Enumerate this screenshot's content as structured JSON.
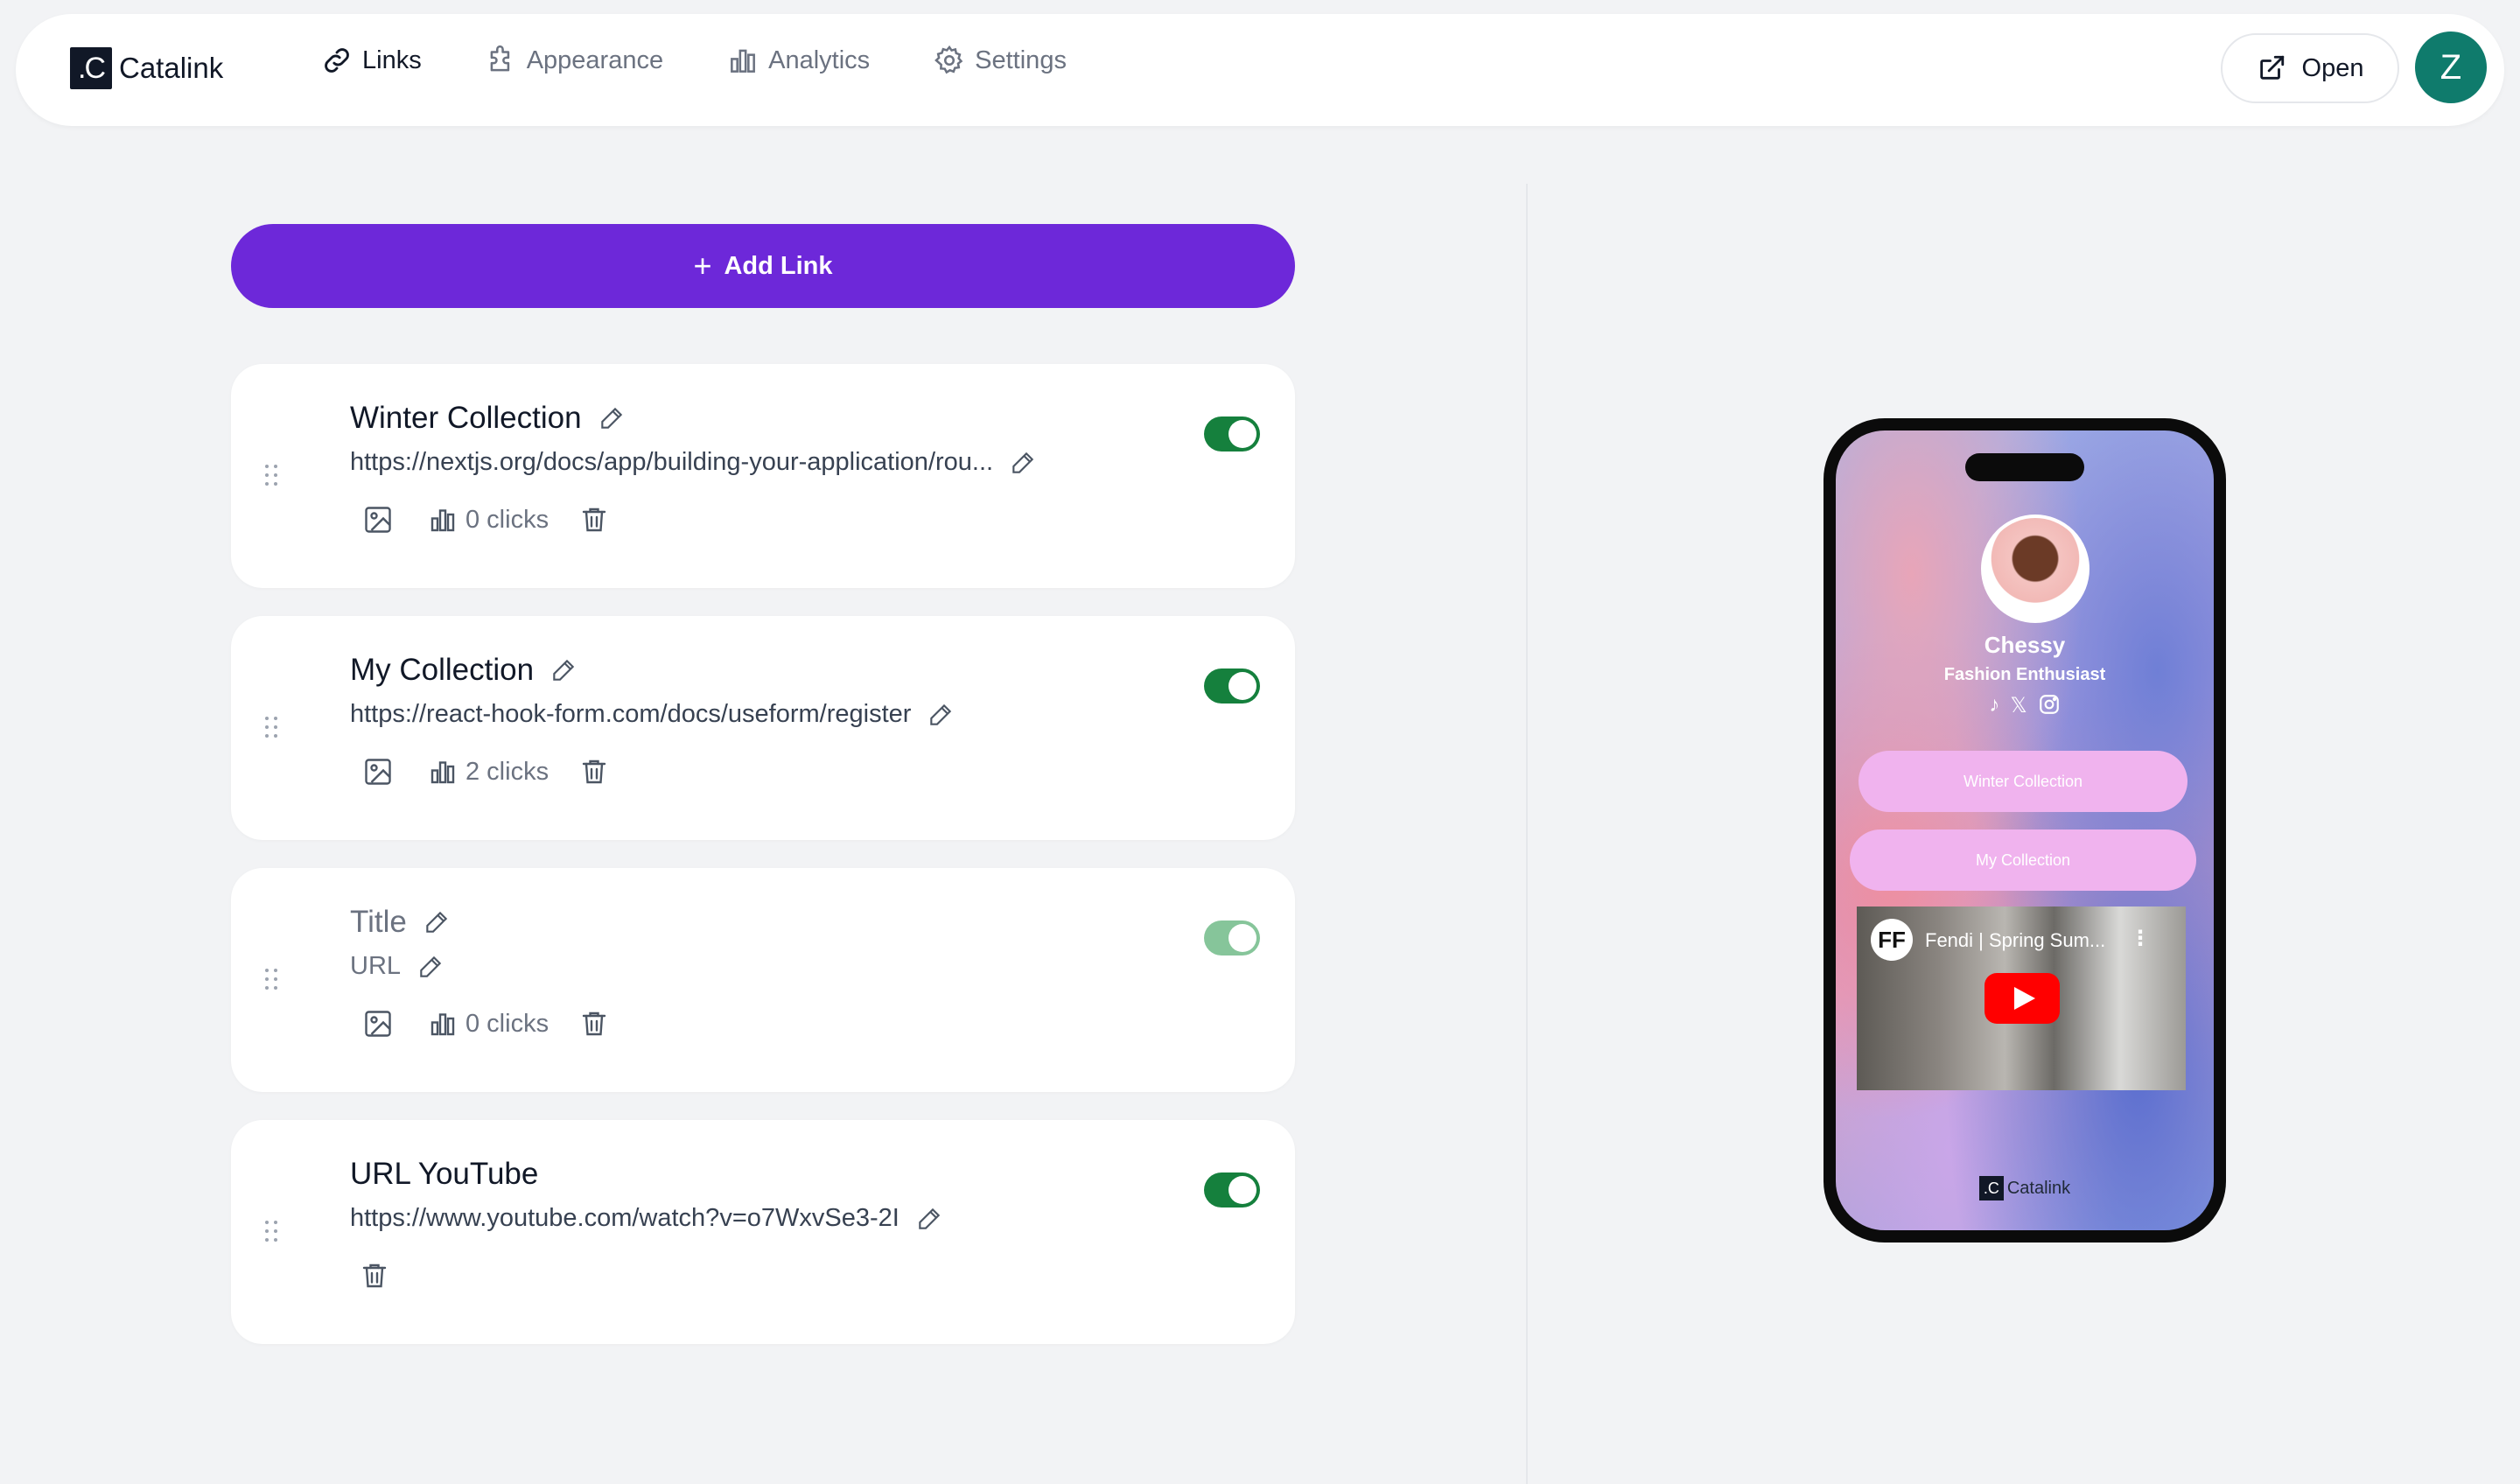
{
  "brand": {
    "logo_text": ".C",
    "name": "Catalink"
  },
  "nav": {
    "items": [
      {
        "label": "Links",
        "icon": "link-icon",
        "active": true
      },
      {
        "label": "Appearance",
        "icon": "puzzle-icon",
        "active": false
      },
      {
        "label": "Analytics",
        "icon": "bar-chart-icon",
        "active": false
      },
      {
        "label": "Settings",
        "icon": "gear-icon",
        "active": false
      }
    ],
    "open_label": "Open",
    "avatar_initial": "Z"
  },
  "add_link": {
    "plus": "+",
    "label": "Add Link"
  },
  "links": [
    {
      "title": "Winter Collection",
      "url": "https://nextjs.org/docs/app/building-your-application/rou...",
      "clicks": "0 clicks",
      "enabled": true,
      "type": "link"
    },
    {
      "title": "My Collection",
      "url": "https://react-hook-form.com/docs/useform/register",
      "clicks": "2 clicks",
      "enabled": true,
      "type": "link"
    },
    {
      "title": "Title",
      "url": "URL",
      "clicks": "0 clicks",
      "enabled": true,
      "placeholder": true,
      "type": "link"
    },
    {
      "title": "URL YouTube",
      "url": "https://www.youtube.com/watch?v=o7WxvSe3-2I",
      "enabled": true,
      "type": "youtube"
    }
  ],
  "preview": {
    "name": "Chessy",
    "bio": "Fashion Enthusiast",
    "socials": [
      "tiktok-icon",
      "x-icon",
      "instagram-icon"
    ],
    "buttons": [
      "Winter Collection",
      "My Collection"
    ],
    "video": {
      "channel_logo": "FF",
      "title": "Fendi | Spring Sum..."
    },
    "footer_logo": ".C",
    "footer_brand": "Catalink"
  },
  "colors": {
    "accent": "#6d28d9",
    "toggle_on": "#15803d",
    "avatar_bg": "#0f7b6c"
  }
}
